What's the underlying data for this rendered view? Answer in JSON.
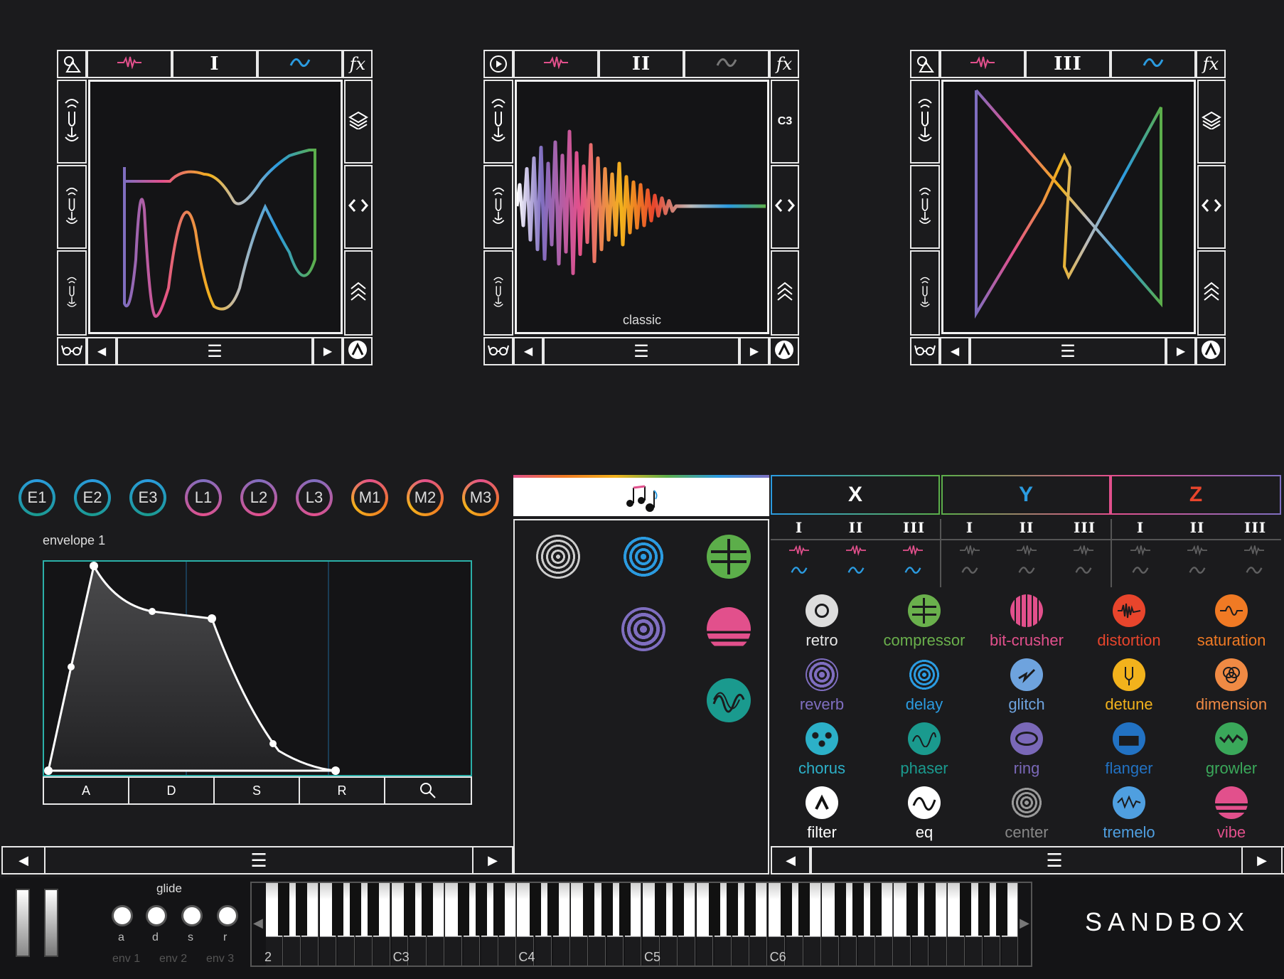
{
  "colors": {
    "bg": "#1b1b1d",
    "panel": "#141416",
    "border": "#e8e8e8",
    "pink": "#e2508c",
    "blue": "#2b9be0",
    "green": "#5cae4a",
    "orange": "#f07a24"
  },
  "oscillators": [
    {
      "roman": "I",
      "fx": "fx",
      "left_icon": "shapes-icon"
    },
    {
      "roman": "II",
      "fx": "fx",
      "left_icon": "play-icon",
      "octave": "C3",
      "label": "classic"
    },
    {
      "roman": "III",
      "fx": "fx",
      "left_icon": "shapes-icon"
    }
  ],
  "mods": {
    "items": [
      "E1",
      "E2",
      "E3",
      "L1",
      "L2",
      "L3",
      "M1",
      "M2",
      "M3"
    ]
  },
  "envelope": {
    "title": "envelope 1",
    "tabs": [
      "A",
      "D",
      "S",
      "R"
    ]
  },
  "axes": {
    "x": "X",
    "y": "Y",
    "z": "Z",
    "sub": [
      "I",
      "II",
      "III"
    ]
  },
  "effects": [
    {
      "label": "retro",
      "color": "#e8e8e8"
    },
    {
      "label": "compressor",
      "color": "#6ab04c"
    },
    {
      "label": "bit-crusher",
      "color": "#e2508c"
    },
    {
      "label": "distortion",
      "color": "#e8452c"
    },
    {
      "label": "saturation",
      "color": "#f07a24"
    },
    {
      "label": "reverb",
      "color": "#7f6ec0"
    },
    {
      "label": "delay",
      "color": "#2b9be0"
    },
    {
      "label": "glitch",
      "color": "#6ea3de"
    },
    {
      "label": "detune",
      "color": "#f2b21c"
    },
    {
      "label": "dimension",
      "color": "#f08a44"
    },
    {
      "label": "chorus",
      "color": "#2cb0c8"
    },
    {
      "label": "phaser",
      "color": "#1a9a8e"
    },
    {
      "label": "ring",
      "color": "#7a68b8"
    },
    {
      "label": "flanger",
      "color": "#2272c3"
    },
    {
      "label": "growler",
      "color": "#3aa85a"
    },
    {
      "label": "filter",
      "color": "#ffffff"
    },
    {
      "label": "eq",
      "color": "#ffffff"
    },
    {
      "label": "center",
      "color": "#888888"
    },
    {
      "label": "tremelo",
      "color": "#4f9fe0"
    },
    {
      "label": "vibe",
      "color": "#e2508c"
    }
  ],
  "keyboard": {
    "glide": "glide",
    "knobs": [
      "a",
      "d",
      "s",
      "r"
    ],
    "envs": [
      "env 1",
      "env 2",
      "env 3"
    ],
    "octaves": [
      "2",
      "C3",
      "C4",
      "C5",
      "C6"
    ]
  },
  "brand": "SANDBOX"
}
